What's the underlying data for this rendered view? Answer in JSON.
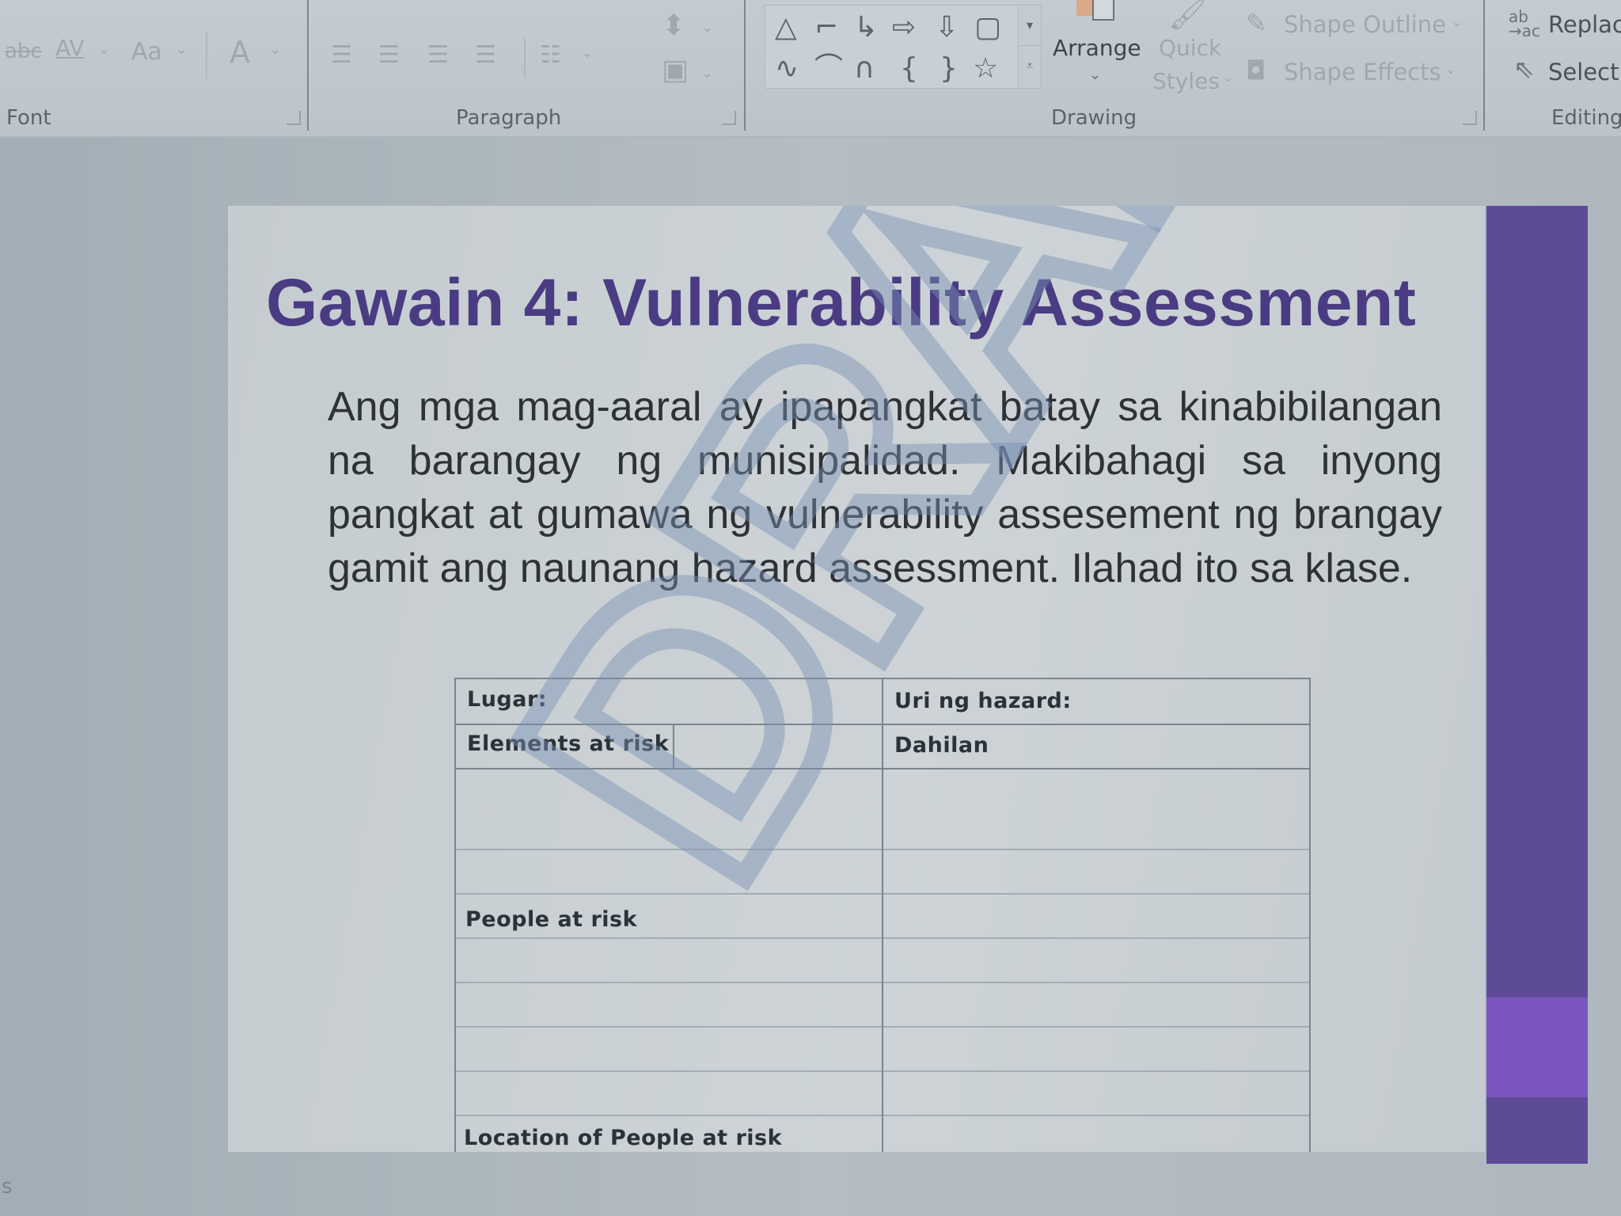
{
  "ribbon": {
    "font_group": {
      "label": "Font",
      "strikethrough_icon": "abc",
      "char_spacing_icon": "AV",
      "change_case_icon": "Aa",
      "font_color_icon": "A"
    },
    "paragraph_group": {
      "label": "Paragraph"
    },
    "drawing_group": {
      "label": "Drawing",
      "shapes_row1": [
        "△",
        "⌐",
        "↳",
        "⇨",
        "⇩",
        "▢"
      ],
      "shapes_row2": [
        "∿",
        "⌒",
        "∩",
        "{",
        "}",
        "☆"
      ],
      "arrange_label": "Arrange",
      "quick_styles_label": "Quick Styles",
      "quick_label_1": "Quick",
      "quick_label_2": "Styles",
      "shape_outline_label": "Shape Outline",
      "shape_effects_label": "Shape Effects"
    },
    "editing_group": {
      "label": "Editing",
      "replace_icon": "ab→ac",
      "replace_label": "Replac",
      "select_label": "Select"
    }
  },
  "slide": {
    "title": "Gawain 4: Vulnerability Assessment",
    "body": "Ang mga mag-aaral ay ipapangkat batay sa kinabibilangan na barangay ng munisipalidad. Makibahagi sa inyong pangkat at gumawa ng vulnerability assesement ng brangay gamit ang naunang hazard assessment. Ilahad ito sa klase.",
    "watermark": "DRAFT",
    "colors": {
      "title": "#4a3c82",
      "accent_bar": "#5e4b98",
      "accent_stripe": "#7c55be"
    },
    "table": {
      "lugar_label": "Lugar:",
      "hazard_type_label": "Uri ng hazard:",
      "elements_at_risk_label": "Elements at risk",
      "reason_label": "Dahilan",
      "people_at_risk_label": "People at risk",
      "location_people_label": "Location of People at risk"
    }
  },
  "status_bar": {
    "fragment": "s"
  }
}
